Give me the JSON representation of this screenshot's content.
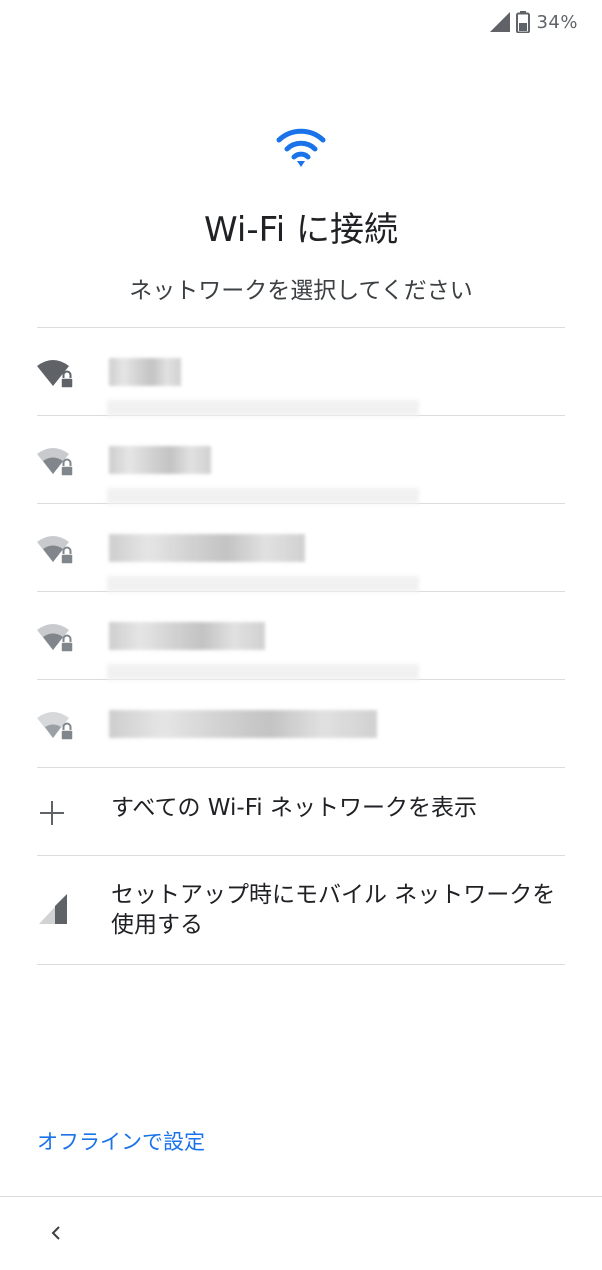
{
  "status_bar": {
    "battery_percent": "34%"
  },
  "header": {
    "title": "Wi-Fi に接続",
    "subtitle": "ネットワークを選択してください"
  },
  "networks": [
    {
      "signal": "strong",
      "secured": true,
      "ssid_blurred": true
    },
    {
      "signal": "weak",
      "secured": true,
      "ssid_blurred": true
    },
    {
      "signal": "weak",
      "secured": true,
      "ssid_blurred": true
    },
    {
      "signal": "weak",
      "secured": true,
      "ssid_blurred": true
    },
    {
      "signal": "weak",
      "secured": true,
      "ssid_blurred": true
    }
  ],
  "options": {
    "show_all_label": "すべての Wi-Fi ネットワークを表示",
    "mobile_network_label": "セットアップ時にモバイル ネットワークを使用する"
  },
  "footer": {
    "offline_label": "オフラインで設定"
  },
  "colors": {
    "accent": "#1a73e8",
    "wifi_icon_blue": "#1a73e8",
    "icon_dark": "#5f6368",
    "icon_light": "#9aa0a6",
    "divider": "#dadce0"
  },
  "icons": {
    "header": "wifi-icon",
    "network_strong": "wifi-signal-strong-lock-icon",
    "network_weak": "wifi-signal-weak-lock-icon",
    "show_all": "plus-icon",
    "mobile": "cellular-signal-icon",
    "back": "chevron-left-icon"
  }
}
